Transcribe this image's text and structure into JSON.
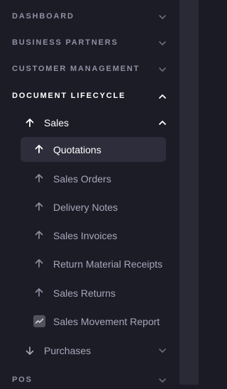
{
  "sections": {
    "dashboard": "DASHBOARD",
    "business_partners": "BUSINESS PARTNERS",
    "customer_management": "CUSTOMER MANAGEMENT",
    "document_lifecycle": "DOCUMENT LIFECYCLE",
    "pos": "POS"
  },
  "submenus": {
    "sales": "Sales",
    "purchases": "Purchases"
  },
  "sales_items": [
    {
      "label": "Quotations",
      "icon": "arrow-up-icon",
      "active": true
    },
    {
      "label": "Sales Orders",
      "icon": "arrow-up-icon"
    },
    {
      "label": "Delivery Notes",
      "icon": "arrow-up-icon"
    },
    {
      "label": "Sales Invoices",
      "icon": "arrow-up-icon"
    },
    {
      "label": "Return Material Receipts",
      "icon": "arrow-up-icon"
    },
    {
      "label": "Sales Returns",
      "icon": "arrow-up-icon"
    },
    {
      "label": "Sales Movement Report",
      "icon": "chart-report-icon"
    }
  ],
  "colors": {
    "background": "#1c1c27",
    "selected": "#2d2d3b",
    "muted_text": "#8f90a2",
    "active_text": "#ffffff"
  }
}
